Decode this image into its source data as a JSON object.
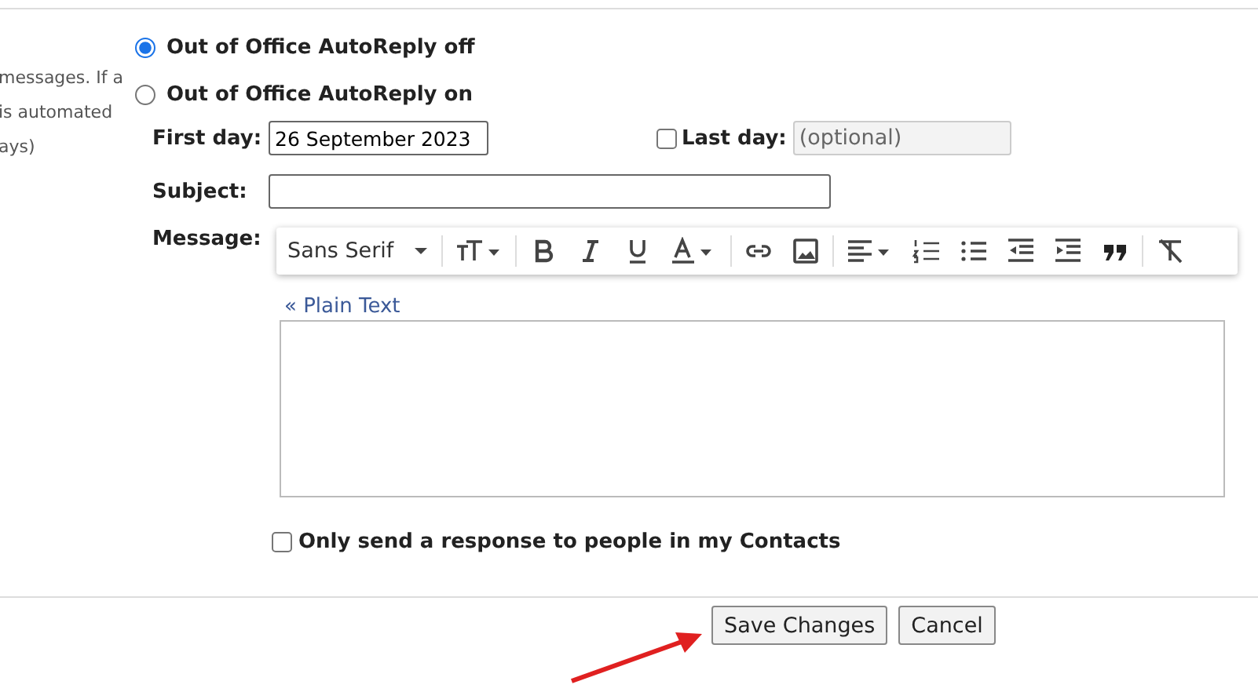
{
  "description_lines": [
    "messages. If a",
    "is automated",
    "ays)"
  ],
  "autoreply_options": [
    {
      "label": "Out of Office AutoReply off",
      "selected": true
    },
    {
      "label": "Out of Office AutoReply on",
      "selected": false
    }
  ],
  "first_day": {
    "label": "First day:",
    "value": "26 September 2023"
  },
  "last_day": {
    "label": "Last day:",
    "checked": false,
    "placeholder": "(optional)"
  },
  "subject": {
    "label": "Subject:"
  },
  "message": {
    "label": "Message:",
    "font": "Sans Serif",
    "plain_text_link": "« Plain Text"
  },
  "contacts_only": {
    "label": "Only send a response to people in my Contacts",
    "checked": false
  },
  "buttons": [
    "Save Changes",
    "Cancel"
  ]
}
